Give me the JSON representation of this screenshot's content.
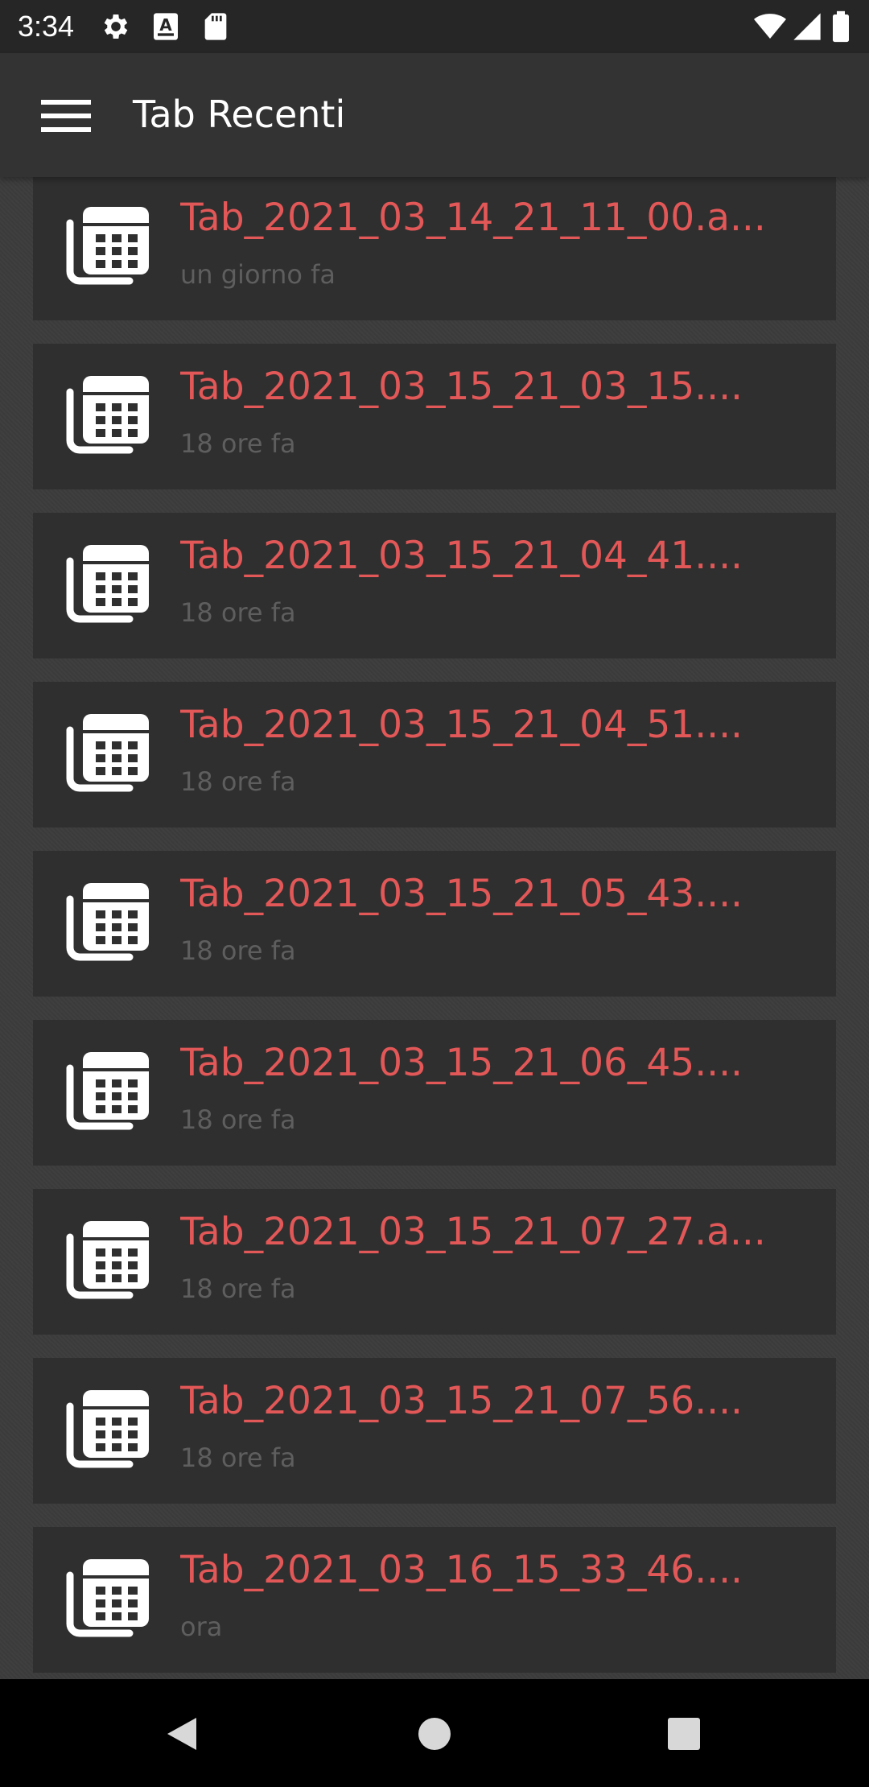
{
  "status_bar": {
    "time": "3:34",
    "icons_left": [
      "settings-icon",
      "a-badge-icon",
      "sd-card-icon"
    ],
    "icons_right": [
      "wifi-icon",
      "signal-icon",
      "battery-icon"
    ]
  },
  "app_bar": {
    "title": "Tab Recenti",
    "menu_icon": "menu-icon"
  },
  "colors": {
    "accent": "#e25757",
    "card_bg": "#2f2f2f",
    "background": "#3c3c3c",
    "app_bar": "#333333",
    "subtitle": "#5e5e5e"
  },
  "recent_files": [
    {
      "title": "Tab_2021_03_14_21_11_00.a...",
      "subtitle": "un giorno fa",
      "icon": "table-copy-icon"
    },
    {
      "title": "Tab_2021_03_15_21_03_15....",
      "subtitle": "18 ore fa",
      "icon": "table-copy-icon"
    },
    {
      "title": "Tab_2021_03_15_21_04_41....",
      "subtitle": "18 ore fa",
      "icon": "table-copy-icon"
    },
    {
      "title": "Tab_2021_03_15_21_04_51....",
      "subtitle": "18 ore fa",
      "icon": "table-copy-icon"
    },
    {
      "title": "Tab_2021_03_15_21_05_43....",
      "subtitle": "18 ore fa",
      "icon": "table-copy-icon"
    },
    {
      "title": "Tab_2021_03_15_21_06_45....",
      "subtitle": "18 ore fa",
      "icon": "table-copy-icon"
    },
    {
      "title": "Tab_2021_03_15_21_07_27.a...",
      "subtitle": "18 ore fa",
      "icon": "table-copy-icon"
    },
    {
      "title": "Tab_2021_03_15_21_07_56....",
      "subtitle": "18 ore fa",
      "icon": "table-copy-icon"
    },
    {
      "title": "Tab_2021_03_16_15_33_46....",
      "subtitle": "ora",
      "icon": "table-copy-icon"
    }
  ],
  "nav_bar": {
    "buttons": [
      "back-icon",
      "home-icon",
      "recents-icon"
    ]
  }
}
